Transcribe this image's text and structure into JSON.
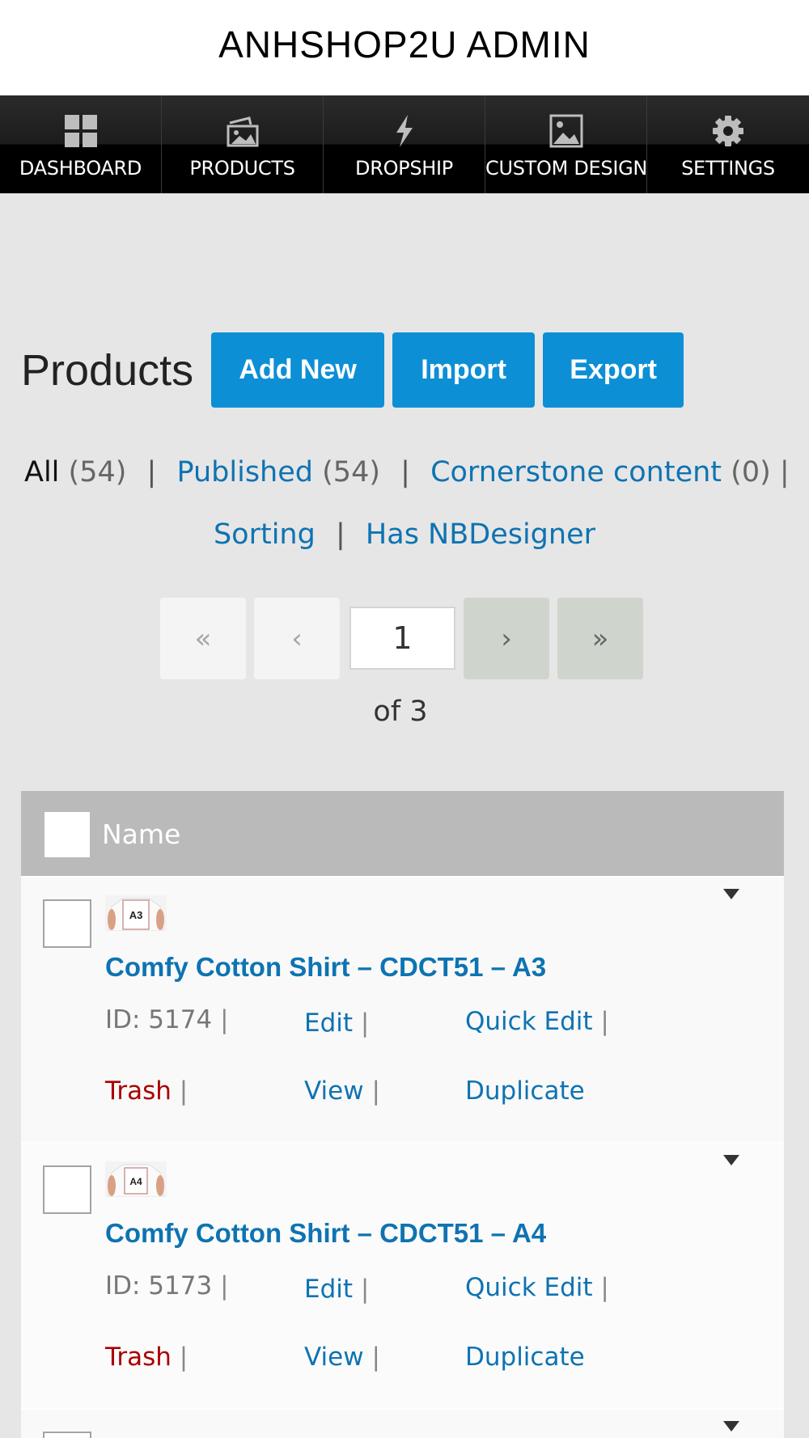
{
  "header": {
    "title": "ANHSHOP2U ADMIN"
  },
  "nav": {
    "items": [
      {
        "label": "DASHBOARD",
        "icon": "dashboard-grid-icon"
      },
      {
        "label": "PRODUCTS",
        "icon": "products-images-icon"
      },
      {
        "label": "DROPSHIP",
        "icon": "lightning-icon"
      },
      {
        "label": "CUSTOM DESIGN",
        "icon": "picture-icon"
      },
      {
        "label": "SETTINGS",
        "icon": "gear-icon"
      }
    ]
  },
  "page": {
    "title": "Products",
    "buttons": {
      "add_new": "Add New",
      "import": "Import",
      "export": "Export"
    }
  },
  "filters": {
    "all": {
      "label": "All",
      "count": "(54)"
    },
    "published": {
      "label": "Published",
      "count": "(54)"
    },
    "cornerstone": {
      "label": "Cornerstone content",
      "count": "(0)"
    },
    "sorting": "Sorting",
    "has_nbdesigner": "Has NBDesigner",
    "separator": "|"
  },
  "pagination": {
    "first": "«",
    "prev": "‹",
    "current": "1",
    "next": "›",
    "last": "»",
    "of_text": "of 3"
  },
  "table": {
    "column_name": "Name",
    "rows": [
      {
        "thumb_label": "A3",
        "name": "Comfy Cotton Shirt – CDCT51 – A3",
        "id_text": "ID: 5174",
        "edit": "Edit",
        "quick_edit": "Quick Edit",
        "trash": "Trash",
        "view": "View",
        "duplicate": "Duplicate"
      },
      {
        "thumb_label": "A4",
        "name": "Comfy Cotton Shirt – CDCT51 – A4",
        "id_text": "ID: 5173",
        "edit": "Edit",
        "quick_edit": "Quick Edit",
        "trash": "Trash",
        "view": "View",
        "duplicate": "Duplicate"
      }
    ],
    "action_separator": "|"
  },
  "colors": {
    "primary_button": "#0d8fd6",
    "link": "#0e73b2",
    "trash": "#aa0000",
    "nav_bg": "#000000",
    "page_bg": "#e6e6e6",
    "table_header": "#bababa"
  }
}
